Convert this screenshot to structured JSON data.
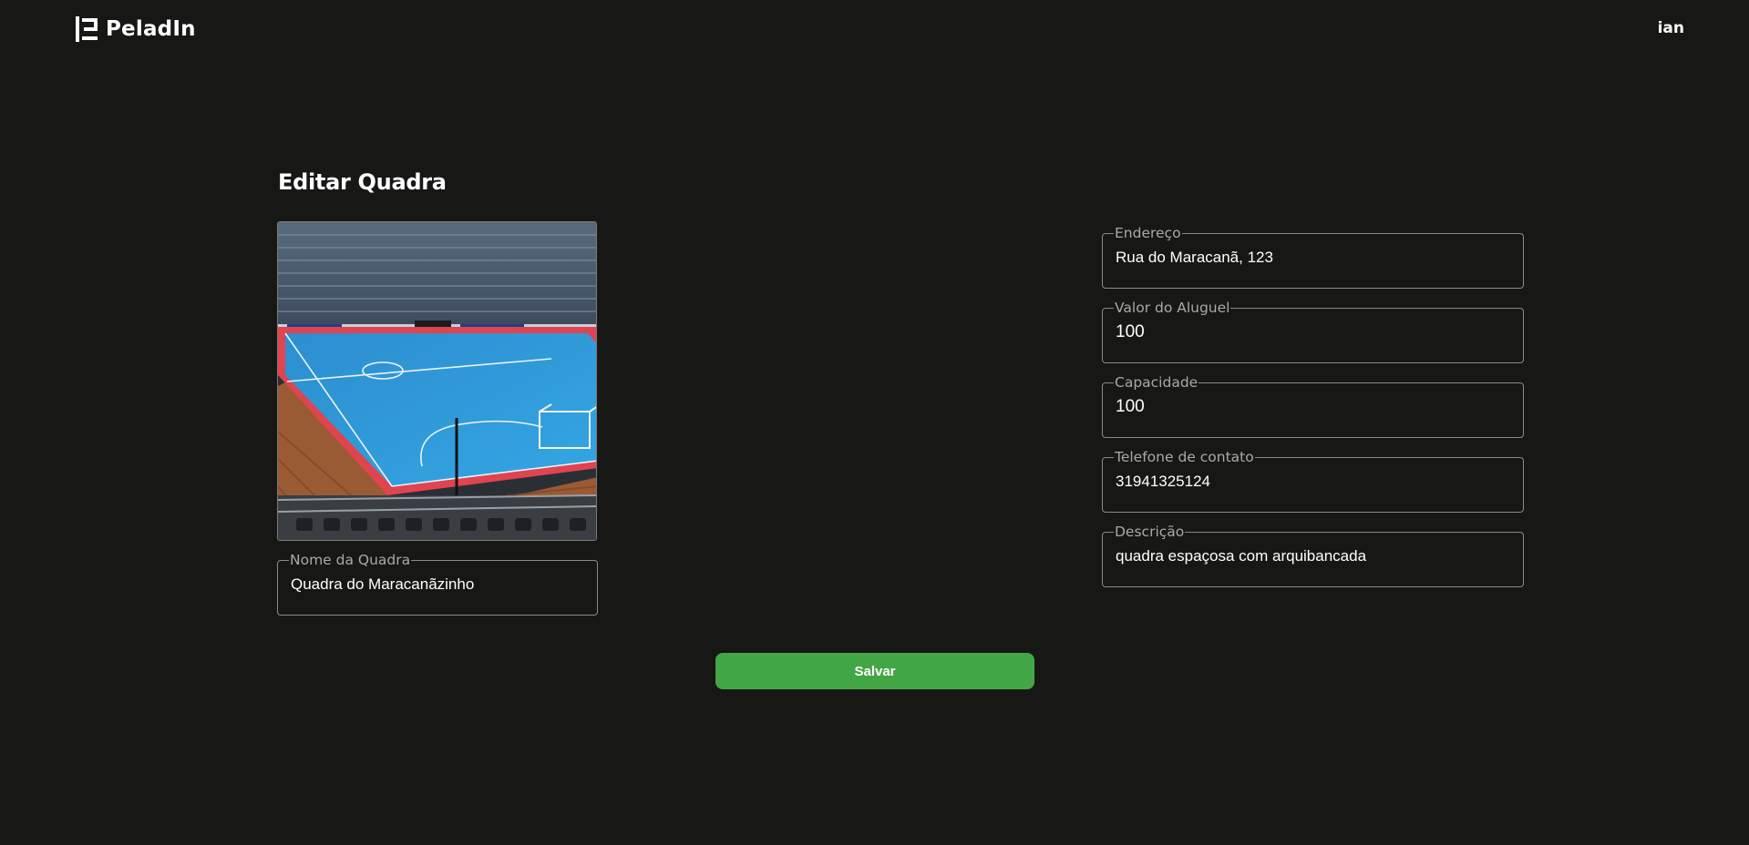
{
  "header": {
    "brand": "PeladIn",
    "user": "ian"
  },
  "page": {
    "title": "Editar Quadra"
  },
  "form": {
    "nome": {
      "label": "Nome da Quadra",
      "value": "Quadra do Maracanãzinho"
    },
    "endereco": {
      "label": "Endereço",
      "value": "Rua do Maracanã, 123"
    },
    "valor": {
      "label": "Valor do Aluguel",
      "value": "100"
    },
    "capacidade": {
      "label": "Capacidade",
      "value": "100"
    },
    "telefone": {
      "label": "Telefone de contato",
      "value": "31941325124"
    },
    "descricao": {
      "label": "Descrição",
      "value": "quadra espaçosa com arquibancada"
    }
  },
  "actions": {
    "save_label": "Salvar"
  },
  "colors": {
    "background": "#171816",
    "primary_button": "#43a645",
    "field_border": "#8a8a8a",
    "label": "#a9a9a9"
  },
  "icons": {
    "brand_logo": "peladin-logo-icon"
  }
}
